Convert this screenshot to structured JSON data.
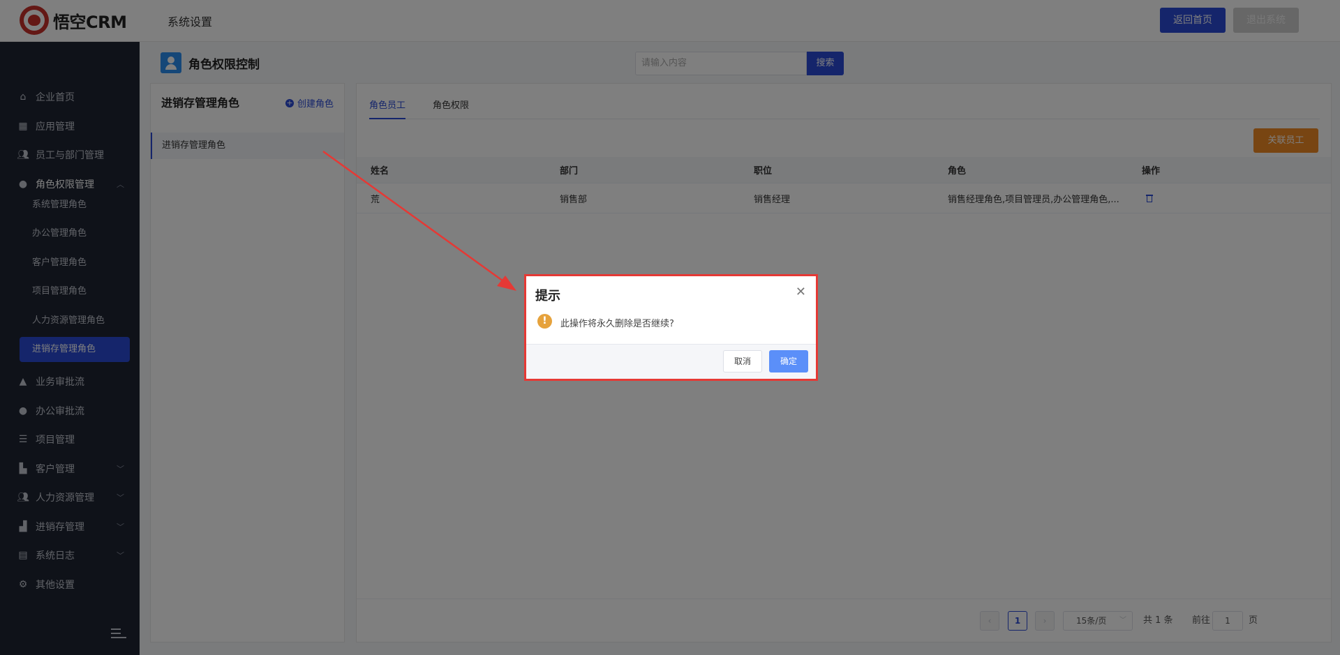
{
  "app": {
    "logo_text": "悟空CRM",
    "section_title": "系统设置"
  },
  "header": {
    "home_label": "返回首页",
    "exit_label": "退出系统"
  },
  "sidebar": {
    "items": [
      {
        "label": "企业首页",
        "icon": "home-icon"
      },
      {
        "label": "应用管理",
        "icon": "grid-icon"
      },
      {
        "label": "员工与部门管理",
        "icon": "users-icon"
      },
      {
        "label": "角色权限管理",
        "icon": "user-icon",
        "expanded": true
      },
      {
        "label": "业务审批流",
        "icon": "stamp-icon"
      },
      {
        "label": "办公审批流",
        "icon": "user-icon"
      },
      {
        "label": "项目管理",
        "icon": "list-icon"
      },
      {
        "label": "客户管理",
        "icon": "building-icon"
      },
      {
        "label": "人力资源管理",
        "icon": "users-icon"
      },
      {
        "label": "进销存管理",
        "icon": "chart-icon"
      },
      {
        "label": "系统日志",
        "icon": "clipboard-icon"
      },
      {
        "label": "其他设置",
        "icon": "gear-icon"
      }
    ],
    "sub_items": [
      "系统管理角色",
      "办公管理角色",
      "客户管理角色",
      "项目管理角色",
      "人力资源管理角色",
      "进销存管理角色"
    ],
    "active_sub": "进销存管理角色"
  },
  "page": {
    "title": "角色权限控制",
    "search_placeholder": "请输入内容",
    "search_label": "搜索"
  },
  "left_panel": {
    "title": "进销存管理角色",
    "create_label": "创建角色",
    "roles": [
      "进销存管理角色"
    ]
  },
  "right_panel": {
    "tabs": [
      "角色员工",
      "角色权限"
    ],
    "active_tab": "角色员工",
    "link_employee_label": "关联员工",
    "columns": [
      "姓名",
      "部门",
      "职位",
      "角色",
      "操作"
    ],
    "rows": [
      {
        "name": "荒",
        "dept": "销售部",
        "position": "销售经理",
        "roles": "销售经理角色,项目管理员,办公管理角色,..."
      }
    ],
    "pagination": {
      "page": "1",
      "page_size": "15条/页",
      "total": "共 1 条",
      "goto_label": "前往",
      "goto_value": "1",
      "page_unit": "页"
    }
  },
  "dialog": {
    "title": "提示",
    "message": "此操作将永久删除是否继续?",
    "cancel_label": "取消",
    "confirm_label": "确定",
    "highlight_color": "#e53935"
  },
  "colors": {
    "primary": "#2a4bd7",
    "sidebar_bg": "#1e2433",
    "accent_orange": "#f08a24",
    "warning": "#e6a23c"
  }
}
